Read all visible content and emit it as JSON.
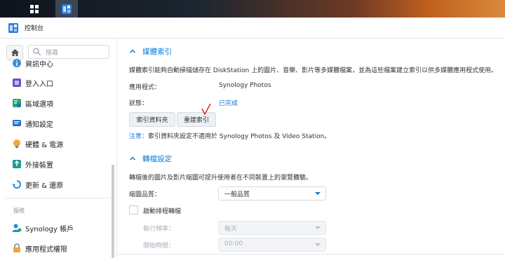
{
  "window": {
    "title": "控制台"
  },
  "sidebar": {
    "search_placeholder": "搜尋",
    "items": [
      {
        "label": "資訊中心",
        "icon": "info-icon"
      },
      {
        "label": "登入入口",
        "icon": "login-portal-icon"
      },
      {
        "label": "區域選項",
        "icon": "regional-options-icon"
      },
      {
        "label": "通知設定",
        "icon": "notification-icon"
      },
      {
        "label": "硬體 & 電源",
        "icon": "hardware-power-icon"
      },
      {
        "label": "外接裝置",
        "icon": "external-devices-icon"
      },
      {
        "label": "更新 & 還原",
        "icon": "update-restore-icon"
      }
    ],
    "group_services": "服務",
    "service_items": [
      {
        "label": "Synology 帳戶",
        "icon": "synology-account-icon"
      },
      {
        "label": "應用程式權限",
        "icon": "application-privileges-icon"
      }
    ]
  },
  "media_index": {
    "title": "媒體索引",
    "description_pre": "媒體索引能夠自動掃描儲存在",
    "description_brand": "DiskStation",
    "description_post": "上的圖片、音樂、影片等多媒體檔案，並為這些檔案建立索引以供多媒體應用程式使用。",
    "app_label": "應用程式：",
    "app_value": "Synology Photos",
    "status_label": "狀態：",
    "status_value": "已完成",
    "btn_indexed_folder": "索引資料夾",
    "btn_reindex": "重建索引",
    "note_prefix": "注意：",
    "note_cn": "索引資料夾設定不適用於",
    "note_app1": "Synology Photos",
    "note_and": "及",
    "note_app2": "Video Station",
    "note_end": "。"
  },
  "conversion": {
    "title": "轉檔設定",
    "description": "轉檔後的圖片及影片縮圖可提升使用者在不同裝置上的瀏覽體驗。",
    "quality_label": "縮圖品質：",
    "quality_value": "一般品質",
    "schedule_label": "啟動排程轉檔",
    "frequency_label": "執行頻率：",
    "frequency_value": "每天",
    "start_time_label": "開始時間：",
    "start_time_value": "00:00"
  },
  "colors": {
    "accent": "#0a7bd6",
    "status_done": "#0a7bd6",
    "annotation": "#e02a2a"
  }
}
